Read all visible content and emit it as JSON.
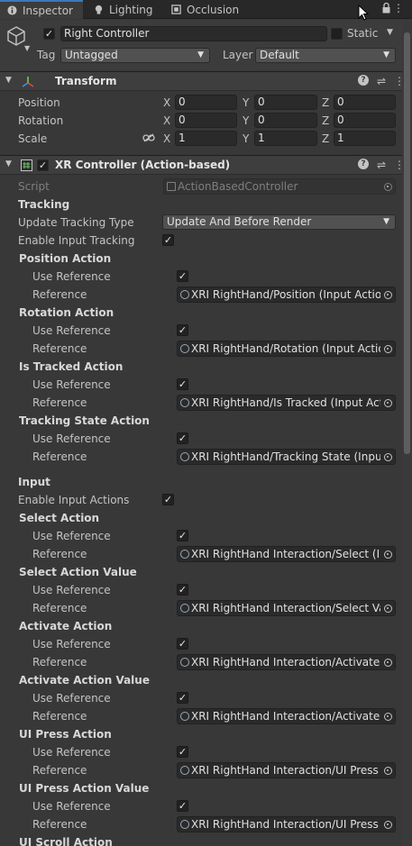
{
  "tabs": [
    {
      "label": "Inspector",
      "icon": "info-icon",
      "active": true
    },
    {
      "label": "Lighting",
      "icon": "bulb-icon",
      "active": false
    },
    {
      "label": "Occlusion",
      "icon": "occlusion-icon",
      "active": false
    }
  ],
  "gameobject": {
    "name": "Right Controller",
    "static_label": "Static",
    "tag_label": "Tag",
    "tag_value": "Untagged",
    "layer_label": "Layer",
    "layer_value": "Default"
  },
  "transform": {
    "title": "Transform",
    "rows": [
      {
        "label": "Position",
        "x": "0",
        "y": "0",
        "z": "0"
      },
      {
        "label": "Rotation",
        "x": "0",
        "y": "0",
        "z": "0"
      },
      {
        "label": "Scale",
        "x": "1",
        "y": "1",
        "z": "1"
      }
    ],
    "axes": [
      "X",
      "Y",
      "Z"
    ]
  },
  "controller": {
    "title": "XR Controller (Action-based)",
    "script_label": "Script",
    "script_value": "ActionBasedController",
    "tracking_header": "Tracking",
    "update_tracking_label": "Update Tracking Type",
    "update_tracking_value": "Update And Before Render",
    "enable_input_tracking_label": "Enable Input Tracking",
    "input_header": "Input",
    "enable_input_actions_label": "Enable Input Actions",
    "use_reference_label": "Use Reference",
    "reference_label": "Reference",
    "tracking_actions": [
      {
        "title": "Position Action",
        "ref": "XRI RightHand/Position (Input Action I"
      },
      {
        "title": "Rotation Action",
        "ref": "XRI RightHand/Rotation (Input Action"
      },
      {
        "title": "Is Tracked Action",
        "ref": "XRI RightHand/Is Tracked (Input Actic"
      },
      {
        "title": "Tracking State Action",
        "ref": "XRI RightHand/Tracking State (Input A"
      }
    ],
    "input_actions": [
      {
        "title": "Select Action",
        "ref": "XRI RightHand Interaction/Select (Inp"
      },
      {
        "title": "Select Action Value",
        "ref": "XRI RightHand Interaction/Select Valu"
      },
      {
        "title": "Activate Action",
        "ref": "XRI RightHand Interaction/Activate (Ir"
      },
      {
        "title": "Activate Action Value",
        "ref": "XRI RightHand Interaction/Activate Va"
      },
      {
        "title": "UI Press Action",
        "ref": "XRI RightHand Interaction/UI Press (Ir"
      },
      {
        "title": "UI Press Action Value",
        "ref": "XRI RightHand Interaction/UI Press Va"
      }
    ],
    "cut_off_title": "UI Scroll Action"
  }
}
